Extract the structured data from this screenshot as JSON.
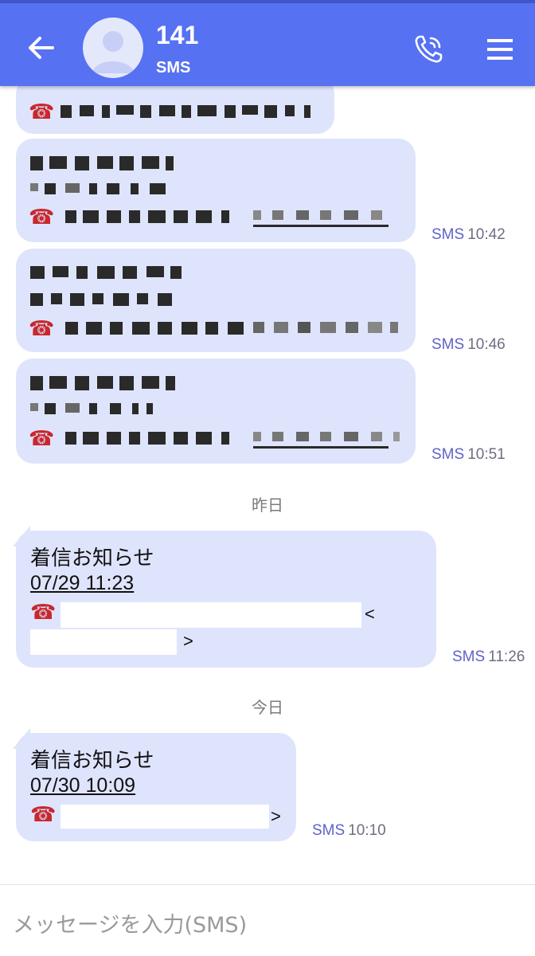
{
  "header": {
    "contact_name": "141",
    "contact_sub": "SMS",
    "accent": "#5671f2"
  },
  "messages": [
    {
      "timestamp_type": "SMS",
      "timestamp_time": "10:42"
    },
    {
      "timestamp_type": "SMS",
      "timestamp_time": "10:46"
    },
    {
      "timestamp_type": "SMS",
      "timestamp_time": "10:51"
    }
  ],
  "date_yesterday": "昨日",
  "msg_yesterday": {
    "title": "着信お知らせ",
    "datetime": "07/29 11:23",
    "bracket_open": "<",
    "bracket_close": ">",
    "timestamp_type": "SMS",
    "timestamp_time": "11:26"
  },
  "date_today": "今日",
  "msg_today": {
    "title": "着信お知らせ",
    "datetime": "07/30 10:09",
    "bracket_close": ">",
    "timestamp_type": "SMS",
    "timestamp_time": "10:10"
  },
  "input": {
    "placeholder": "メッセージを入力(SMS)"
  },
  "icons": {
    "back": "arrow-left-icon",
    "avatar": "person-icon",
    "call": "phone-call-icon",
    "menu": "hamburger-menu-icon",
    "phone": "telephone-icon"
  }
}
